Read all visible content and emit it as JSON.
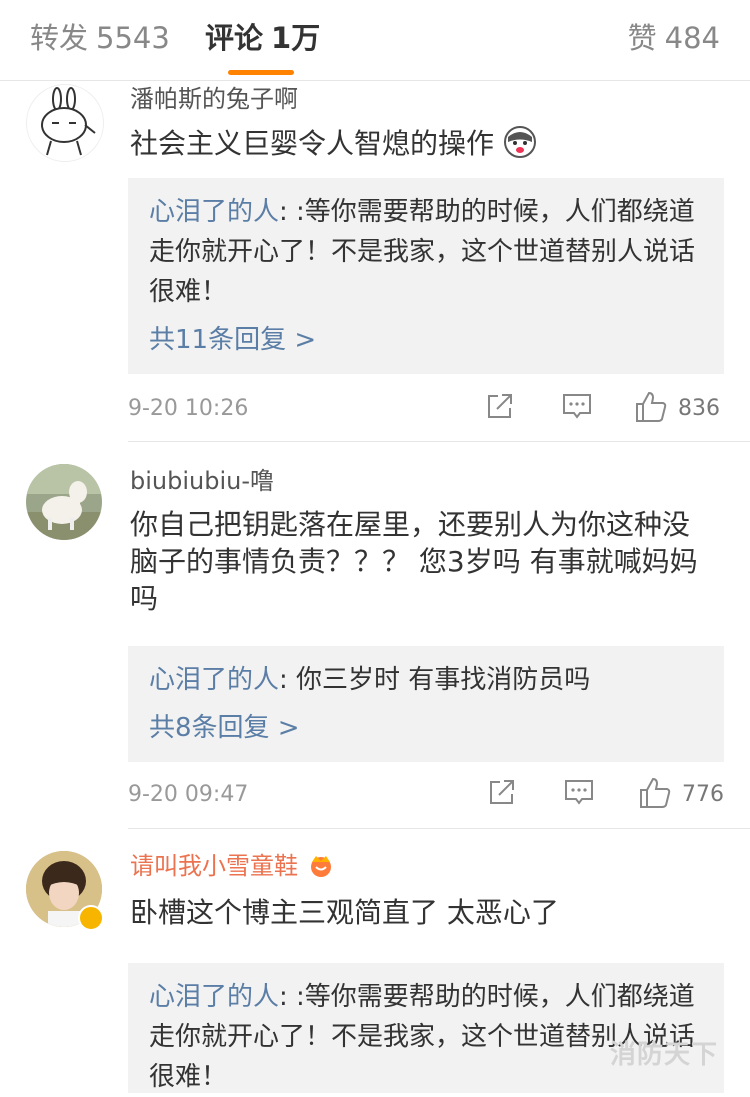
{
  "tabs": {
    "repost_label": "转发",
    "repost_count": "5543",
    "comment_label": "评论",
    "comment_count": "1万",
    "like_label": "赞",
    "like_count": "484"
  },
  "comments": [
    {
      "username": "潘帕斯的兔子啊",
      "text": "社会主义巨婴令人智熄的操作",
      "reply_author": "心泪了的人",
      "reply_text": ": :等你需要帮助的时候，人们都绕道走你就开心了！不是我家，这个世道替别人说话很难！",
      "reply_more": "共11条回复 >",
      "time": "9-20 10:26",
      "likes": "836"
    },
    {
      "username": "biubiubiu-噜",
      "text": "你自己把钥匙落在屋里，还要别人为你这种没脑子的事情负责？？？ 您3岁吗 有事就喊妈妈吗",
      "reply_author": "心泪了的人",
      "reply_text": ": 你三岁时 有事找消防员吗",
      "reply_more": "共8条回复 >",
      "time": "9-20 09:47",
      "likes": "776"
    },
    {
      "username": "请叫我小雪童鞋",
      "text": "卧槽这个博主三观简直了 太恶心了",
      "reply_author": "心泪了的人",
      "reply_text": ": :等你需要帮助的时候，人们都绕道走你就开心了！不是我家，这个世道替别人说话很难！"
    }
  ],
  "watermark": "消防天下",
  "colors": {
    "accent": "#ff8200",
    "link": "#5b7ea6",
    "vip_name": "#eb7350",
    "reply_bg": "#f2f2f2"
  }
}
